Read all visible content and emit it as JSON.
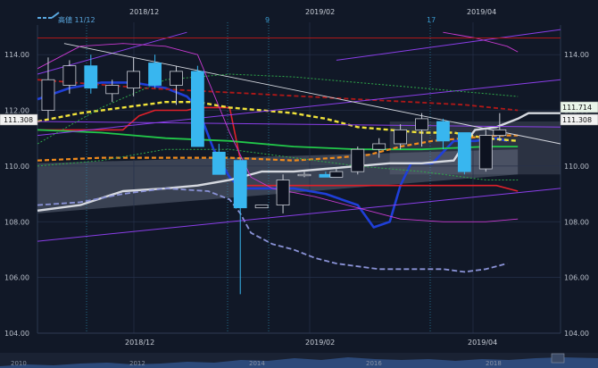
{
  "legend": {
    "label": "高値 11/12"
  },
  "top_axis": [
    "2018/12",
    "2019/02",
    "2019/04"
  ],
  "bottom_axis": [
    "2018/12",
    "2019/02",
    "2019/04"
  ],
  "markers": [
    "9",
    "17"
  ],
  "navigator": {
    "years": [
      "2010",
      "2012",
      "2014",
      "2016",
      "2018"
    ]
  },
  "price_boxes": {
    "left": "111.308",
    "right_last": "111.714",
    "right_ref": "111.308"
  },
  "colors": {
    "background": "#111827",
    "candle_up": "#0d1220",
    "candle_down": "#38b6ef",
    "ma_short": "#1f3fd8",
    "ma_mid": "#f0e23a",
    "ma_long": "#22c94a",
    "ma_orange": "#f08a1c",
    "kijun": "#e0202a",
    "darkred": "#b01818",
    "white_line": "#d6d9e0",
    "lavender": "#8a92d6",
    "purple": "#8a3ee8",
    "green_dotted": "#2fa84a",
    "magenta": "#c83ad0"
  },
  "chart_data": {
    "type": "candlestick",
    "title": "",
    "xlabel": "",
    "ylabel": "",
    "ylim": [
      104,
      115
    ],
    "y_ticks": [
      104,
      106,
      108,
      110,
      112,
      114
    ],
    "y_tick_labels": [
      "104.00",
      "106.00",
      "108.00",
      "110.00",
      "112.00",
      "114.00"
    ],
    "x_range": [
      0,
      33
    ],
    "grid": true,
    "candles": [
      {
        "x": 1,
        "o": 112.0,
        "h": 113.9,
        "l": 111.7,
        "c": 113.1
      },
      {
        "x": 3,
        "o": 112.9,
        "h": 113.8,
        "l": 112.6,
        "c": 113.6
      },
      {
        "x": 5,
        "o": 113.6,
        "h": 114.0,
        "l": 112.6,
        "c": 112.8
      },
      {
        "x": 7,
        "o": 112.6,
        "h": 113.1,
        "l": 112.3,
        "c": 112.9
      },
      {
        "x": 9,
        "o": 112.8,
        "h": 113.9,
        "l": 112.5,
        "c": 113.4
      },
      {
        "x": 11,
        "o": 113.7,
        "h": 114.0,
        "l": 112.8,
        "c": 112.9
      },
      {
        "x": 13,
        "o": 112.9,
        "h": 113.6,
        "l": 112.2,
        "c": 113.4
      },
      {
        "x": 15,
        "o": 113.4,
        "h": 113.6,
        "l": 110.7,
        "c": 110.7
      },
      {
        "x": 17,
        "o": 110.5,
        "h": 110.8,
        "l": 109.7,
        "c": 109.7
      },
      {
        "x": 19,
        "o": 110.2,
        "h": 110.3,
        "l": 105.4,
        "c": 108.5
      },
      {
        "x": 21,
        "o": 108.5,
        "h": 108.6,
        "l": 108.5,
        "c": 108.6
      },
      {
        "x": 23,
        "o": 108.6,
        "h": 109.7,
        "l": 108.3,
        "c": 109.5
      },
      {
        "x": 25,
        "o": 109.7,
        "h": 109.8,
        "l": 109.6,
        "c": 109.7
      },
      {
        "x": 27,
        "o": 109.7,
        "h": 109.8,
        "l": 109.6,
        "c": 109.6
      },
      {
        "x": 28,
        "o": 109.6,
        "h": 109.9,
        "l": 109.6,
        "c": 109.8
      },
      {
        "x": 30,
        "o": 109.8,
        "h": 110.7,
        "l": 109.7,
        "c": 110.6
      },
      {
        "x": 32,
        "o": 110.6,
        "h": 111.0,
        "l": 110.3,
        "c": 110.8
      },
      {
        "x": 34,
        "o": 110.8,
        "h": 111.5,
        "l": 110.6,
        "c": 111.3
      },
      {
        "x": 36,
        "o": 111.3,
        "h": 111.9,
        "l": 110.7,
        "c": 111.7
      },
      {
        "x": 38,
        "o": 111.6,
        "h": 111.7,
        "l": 110.6,
        "c": 110.9
      },
      {
        "x": 40,
        "o": 111.2,
        "h": 111.2,
        "l": 109.7,
        "c": 109.8
      },
      {
        "x": 42,
        "o": 109.9,
        "h": 111.3,
        "l": 109.8,
        "c": 111.1
      },
      {
        "x": 43.3,
        "o": 111.1,
        "h": 111.9,
        "l": 110.9,
        "c": 111.3
      }
    ],
    "x_max": 45,
    "series": [
      {
        "key": "ma_short",
        "dash": "",
        "width": 2.6,
        "points": [
          [
            0,
            112.4
          ],
          [
            3,
            112.8
          ],
          [
            6,
            113.0
          ],
          [
            9,
            113.0
          ],
          [
            12,
            112.8
          ],
          [
            14,
            112.5
          ],
          [
            15,
            112.1
          ],
          [
            16.5,
            110.6
          ],
          [
            18,
            109.6
          ],
          [
            19,
            109.2
          ],
          [
            21,
            109.2
          ],
          [
            24,
            109.2
          ],
          [
            27,
            109.0
          ],
          [
            30,
            108.6
          ],
          [
            31.5,
            107.8
          ],
          [
            33,
            108.0
          ],
          [
            34,
            109.3
          ],
          [
            35,
            110.1
          ],
          [
            37,
            110.1
          ],
          [
            39,
            110.9
          ],
          [
            41,
            110.9
          ],
          [
            43,
            111.0
          ],
          [
            44,
            110.9
          ]
        ]
      },
      {
        "key": "kijun",
        "dash": "",
        "width": 1.6,
        "points": [
          [
            0,
            111.3
          ],
          [
            6,
            111.3
          ],
          [
            8,
            111.3
          ],
          [
            9.5,
            111.8
          ],
          [
            11,
            112.0
          ],
          [
            14,
            112.0
          ],
          [
            15,
            112.1
          ],
          [
            18,
            112.1
          ],
          [
            19.5,
            109.3
          ],
          [
            33,
            109.3
          ],
          [
            43,
            109.3
          ],
          [
            45,
            109.1
          ]
        ]
      },
      {
        "key": "ma_mid",
        "dash": "5,3",
        "width": 2.4,
        "points": [
          [
            0,
            111.6
          ],
          [
            4,
            111.9
          ],
          [
            8,
            112.1
          ],
          [
            12,
            112.3
          ],
          [
            15,
            112.3
          ],
          [
            18,
            112.1
          ],
          [
            21,
            112.0
          ],
          [
            24,
            111.9
          ],
          [
            27,
            111.7
          ],
          [
            30,
            111.4
          ],
          [
            33,
            111.3
          ],
          [
            36,
            111.2
          ],
          [
            39,
            111.2
          ],
          [
            42,
            111.0
          ],
          [
            45,
            110.9
          ]
        ]
      },
      {
        "key": "ma_long",
        "dash": "",
        "width": 1.8,
        "points": [
          [
            0,
            111.3
          ],
          [
            6,
            111.2
          ],
          [
            12,
            111.0
          ],
          [
            18,
            110.9
          ],
          [
            24,
            110.7
          ],
          [
            30,
            110.6
          ],
          [
            36,
            110.6
          ],
          [
            42,
            110.7
          ],
          [
            45,
            110.7
          ]
        ]
      },
      {
        "key": "ma_orange",
        "dash": "5,3",
        "width": 2.2,
        "points": [
          [
            0,
            110.2
          ],
          [
            6,
            110.3
          ],
          [
            12,
            110.3
          ],
          [
            18,
            110.3
          ],
          [
            24,
            110.2
          ],
          [
            28,
            110.3
          ],
          [
            31,
            110.4
          ],
          [
            34,
            110.7
          ],
          [
            37,
            110.9
          ],
          [
            40,
            111.0
          ],
          [
            43,
            111.1
          ],
          [
            45,
            111.1
          ]
        ]
      },
      {
        "key": "darkred",
        "dash": "5,3",
        "width": 1.8,
        "points": [
          [
            0,
            113.1
          ],
          [
            10,
            112.8
          ],
          [
            20,
            112.6
          ],
          [
            30,
            112.4
          ],
          [
            40,
            112.2
          ],
          [
            45,
            112.0
          ]
        ]
      },
      {
        "key": "white_line",
        "dash": "",
        "width": 2.4,
        "points": [
          [
            0,
            108.4
          ],
          [
            4,
            108.6
          ],
          [
            8,
            109.1
          ],
          [
            12,
            109.2
          ],
          [
            15,
            109.3
          ],
          [
            18,
            109.5
          ],
          [
            21,
            109.8
          ],
          [
            24,
            109.8
          ],
          [
            27,
            109.9
          ],
          [
            30,
            110.0
          ],
          [
            33,
            110.1
          ],
          [
            36,
            110.1
          ],
          [
            39,
            110.2
          ],
          [
            40,
            110.8
          ],
          [
            41,
            111.3
          ],
          [
            43,
            111.4
          ],
          [
            45,
            111.7
          ],
          [
            46,
            111.9
          ],
          [
            49,
            111.9
          ]
        ]
      },
      {
        "key": "lavender",
        "dash": "6,3",
        "width": 1.8,
        "points": [
          [
            0,
            108.6
          ],
          [
            4,
            108.7
          ],
          [
            8,
            109.0
          ],
          [
            12,
            109.2
          ],
          [
            16,
            109.1
          ],
          [
            18,
            108.8
          ],
          [
            19,
            108.3
          ],
          [
            20,
            107.6
          ],
          [
            22,
            107.2
          ],
          [
            24,
            107.0
          ],
          [
            26,
            106.7
          ],
          [
            28,
            106.5
          ],
          [
            30,
            106.4
          ],
          [
            32,
            106.3
          ],
          [
            34,
            106.3
          ],
          [
            36,
            106.3
          ],
          [
            38,
            106.3
          ],
          [
            40,
            106.2
          ],
          [
            42,
            106.3
          ],
          [
            44,
            106.5
          ]
        ]
      },
      {
        "key": "purple",
        "dash": "",
        "width": 1.0,
        "points": [
          [
            0,
            107.3
          ],
          [
            49,
            109.2
          ]
        ]
      },
      {
        "key": "purple",
        "dash": "",
        "width": 1.0,
        "points": [
          [
            0,
            111.1
          ],
          [
            49,
            113.1
          ]
        ]
      },
      {
        "key": "purple",
        "dash": "",
        "width": 1.0,
        "points": [
          [
            0,
            113.3
          ],
          [
            14,
            114.8
          ]
        ]
      },
      {
        "key": "purple",
        "dash": "",
        "width": 1.0,
        "points": [
          [
            28,
            113.8
          ],
          [
            49,
            114.9
          ]
        ]
      },
      {
        "key": "purple",
        "dash": "",
        "width": 1.0,
        "points": [
          [
            0,
            111.6
          ],
          [
            49,
            111.4
          ]
        ]
      },
      {
        "key": "white_line",
        "dash": "",
        "width": 0.9,
        "points": [
          [
            2.5,
            114.4
          ],
          [
            49,
            110.8
          ]
        ]
      },
      {
        "key": "green_dotted",
        "dash": "2,2",
        "width": 1.0,
        "points": [
          [
            0,
            110.8
          ],
          [
            6,
            112.1
          ],
          [
            12,
            113.1
          ],
          [
            18,
            113.3
          ],
          [
            24,
            113.2
          ],
          [
            30,
            113.0
          ],
          [
            36,
            112.8
          ],
          [
            42,
            112.6
          ],
          [
            45,
            112.5
          ]
        ]
      },
      {
        "key": "green_dotted",
        "dash": "2,2",
        "width": 1.0,
        "points": [
          [
            0,
            110.0
          ],
          [
            6,
            110.2
          ],
          [
            12,
            110.6
          ],
          [
            18,
            110.6
          ],
          [
            24,
            110.3
          ],
          [
            30,
            110.0
          ],
          [
            36,
            109.8
          ],
          [
            42,
            109.5
          ],
          [
            45,
            109.5
          ]
        ]
      },
      {
        "key": "magenta",
        "dash": "",
        "width": 0.9,
        "points": [
          [
            0,
            113.5
          ],
          [
            4,
            114.3
          ],
          [
            8,
            114.4
          ],
          [
            12,
            114.3
          ],
          [
            15,
            114.0
          ],
          [
            18,
            111.2
          ],
          [
            20,
            109.6
          ],
          [
            22,
            109.2
          ],
          [
            26,
            108.9
          ],
          [
            30,
            108.5
          ],
          [
            34,
            108.1
          ],
          [
            38,
            108.0
          ],
          [
            42,
            108.0
          ],
          [
            45,
            108.1
          ]
        ]
      },
      {
        "key": "magenta",
        "dash": "",
        "width": 0.9,
        "points": [
          [
            38,
            114.8
          ],
          [
            41,
            114.6
          ],
          [
            44,
            114.3
          ],
          [
            45,
            114.1
          ]
        ]
      },
      {
        "key": "darkred",
        "dash": "",
        "width": 1.0,
        "points": [
          [
            0,
            114.6
          ],
          [
            49,
            114.6
          ]
        ]
      }
    ]
  }
}
